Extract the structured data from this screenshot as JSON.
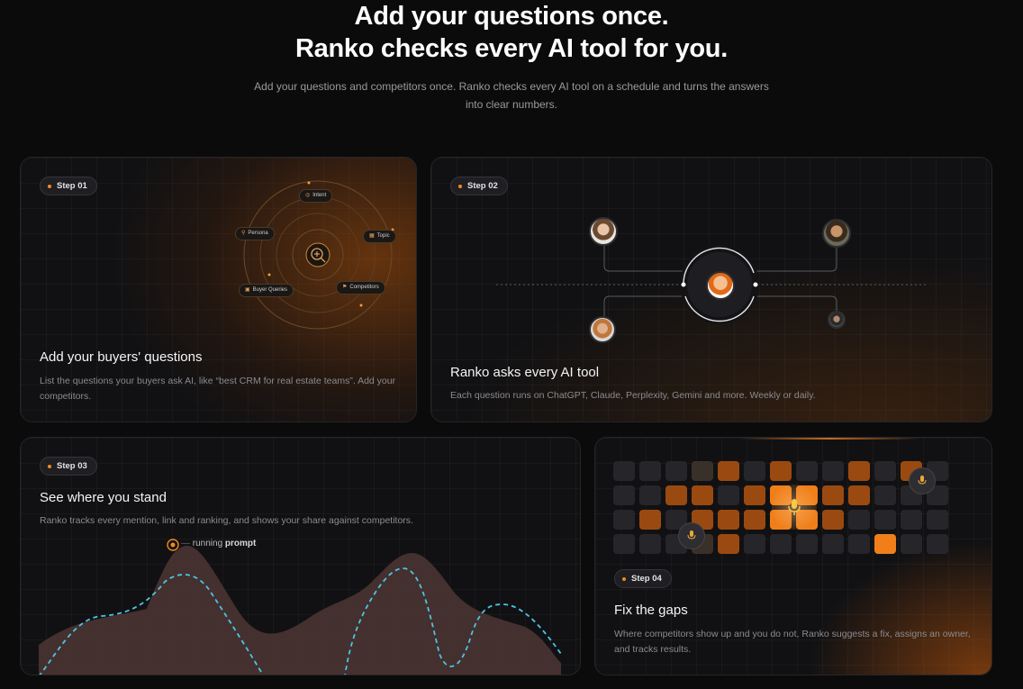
{
  "hero": {
    "title_line1": "Add your questions once.",
    "title_line2": "Ranko checks every AI tool for you.",
    "subtitle": "Add your questions and competitors once. Ranko checks every AI tool on a schedule and turns the answers into clear numbers."
  },
  "steps": [
    {
      "label": "Step 01",
      "title": "Add your buyers' questions",
      "description": "List the questions your buyers ask AI, like “best CRM for real estate teams”. Add your competitors.",
      "tags": [
        "Intent",
        "Persona",
        "Topic",
        "Buyer Queries",
        "Competitors"
      ]
    },
    {
      "label": "Step 02",
      "title": "Ranko asks every AI tool",
      "description": "Each question runs on ChatGPT, Claude, Perplexity, Gemini and more. Weekly or daily."
    },
    {
      "label": "Step 03",
      "title": "See where you stand",
      "description": "Ranko tracks every mention, link and ranking, and shows your share against competitors.",
      "legend_prefix": "running",
      "legend_bold": "prompt"
    },
    {
      "label": "Step 04",
      "title": "Fix the gaps",
      "description": "Where competitors show up and you do not, Ranko suggests a fix, assigns an owner, and tracks results."
    }
  ],
  "icons": {
    "step_dot": "orange-dot-icon",
    "intent": "target-icon",
    "persona": "person-icon",
    "topic": "grid-icon",
    "buyer_queries": "chat-icon",
    "competitors": "flag-icon",
    "search": "search-plus-icon",
    "microphone": "microphone-icon",
    "running": "radio-dot-icon"
  },
  "colors": {
    "accent": "#f28a1e",
    "background": "#0b0b0c",
    "card": "#111113",
    "line_dash": "#4cc4e6",
    "area": "#4a3432"
  }
}
